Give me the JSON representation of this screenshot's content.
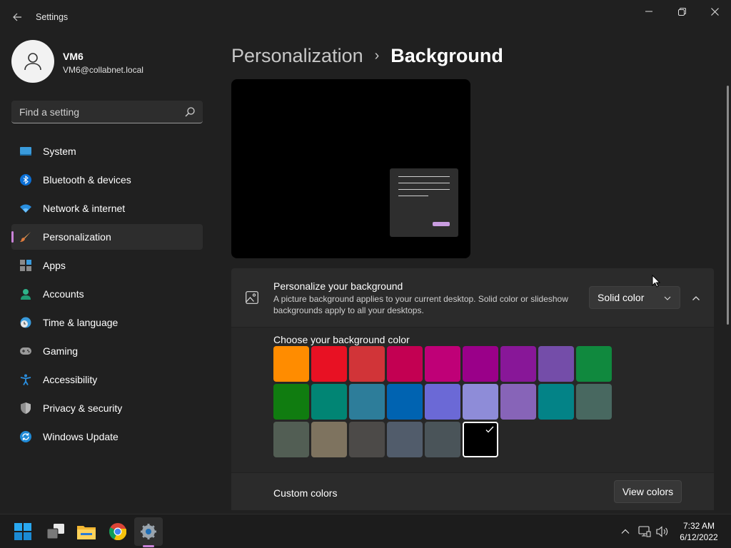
{
  "window": {
    "title": "Settings"
  },
  "profile": {
    "name": "VM6",
    "email": "VM6@collabnet.local"
  },
  "search": {
    "placeholder": "Find a setting"
  },
  "sidebar": {
    "items": [
      {
        "label": "System",
        "icon": "system-icon"
      },
      {
        "label": "Bluetooth & devices",
        "icon": "bluetooth-icon"
      },
      {
        "label": "Network & internet",
        "icon": "wifi-icon"
      },
      {
        "label": "Personalization",
        "icon": "brush-icon",
        "active": true
      },
      {
        "label": "Apps",
        "icon": "apps-icon"
      },
      {
        "label": "Accounts",
        "icon": "accounts-icon"
      },
      {
        "label": "Time & language",
        "icon": "clock-globe-icon"
      },
      {
        "label": "Gaming",
        "icon": "gamepad-icon"
      },
      {
        "label": "Accessibility",
        "icon": "accessibility-icon"
      },
      {
        "label": "Privacy & security",
        "icon": "shield-icon"
      },
      {
        "label": "Windows Update",
        "icon": "update-icon"
      }
    ]
  },
  "breadcrumb": {
    "parent": "Personalization",
    "separator": "›",
    "current": "Background"
  },
  "background": {
    "title": "Personalize your background",
    "description": "A picture background applies to your current desktop. Solid color or slideshow backgrounds apply to all your desktops.",
    "dropdown_value": "Solid color",
    "color_title": "Choose your background color",
    "colors": [
      "#ff8c00",
      "#e81123",
      "#d13438",
      "#c30052",
      "#bf0077",
      "#9a0089",
      "#881798",
      "#744da9",
      "#10893e",
      "#107c10",
      "#018574",
      "#2d7d9a",
      "#0063b1",
      "#6b69d6",
      "#8e8cd8",
      "#8764b8",
      "#038387",
      "#486860",
      "#525e54",
      "#7e735f",
      "#4c4a48",
      "#515c6b",
      "#4a5459",
      "#000000"
    ],
    "selected_color": "#000000",
    "custom_label": "Custom colors",
    "view_colors_label": "View colors"
  },
  "taskbar": {
    "apps": [
      "start-icon",
      "task-view-icon",
      "file-explorer-icon",
      "chrome-icon",
      "settings-icon"
    ],
    "time": "7:32 AM",
    "date": "6/12/2022"
  },
  "accent": "#c982d8"
}
